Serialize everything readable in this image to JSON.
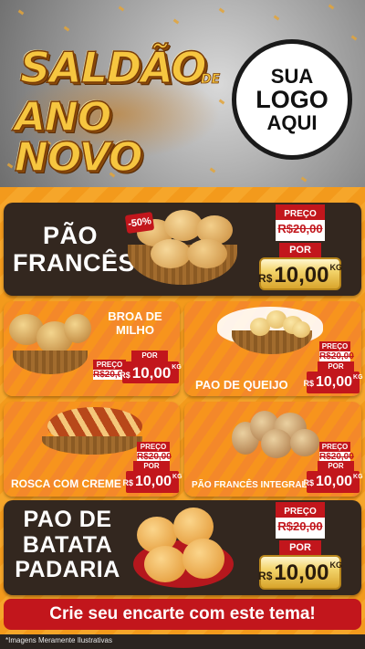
{
  "header": {
    "title_line1": "SALDÃO",
    "title_de": "DE",
    "title_line2": "ANO NOVO",
    "logo_line1": "SUA",
    "logo_line2": "LOGO",
    "logo_line3": "AQUI"
  },
  "products": {
    "pao_frances": {
      "name": "PÃO FRANCÊS",
      "discount": "-50%",
      "preco_label": "PREÇO",
      "old_price": "R$20,00",
      "por_label": "POR",
      "currency": "R$",
      "price": "10,00",
      "unit": "KG"
    },
    "broa": {
      "name": "BROA DE MILHO",
      "preco_label": "PREÇO",
      "old_price": "R$20,00",
      "por_label": "POR",
      "currency": "R$",
      "price": "10,00",
      "unit": "KG"
    },
    "pao_queijo": {
      "name": "PAO DE QUEIJO",
      "preco_label": "PREÇO",
      "old_price": "R$20,00",
      "por_label": "POR",
      "currency": "R$",
      "price": "10,00",
      "unit": "KG"
    },
    "rosca": {
      "name": "ROSCA COM CREME",
      "preco_label": "PREÇO",
      "old_price": "R$20,00",
      "por_label": "POR",
      "currency": "R$",
      "price": "10,00",
      "unit": "KG"
    },
    "pao_integral": {
      "name": "PÃO FRANCÊS INTEGRAL",
      "preco_label": "PREÇO",
      "old_price": "R$20,00",
      "por_label": "POR",
      "currency": "R$",
      "price": "10,00",
      "unit": "KG"
    },
    "pao_batata": {
      "name": "PAO DE BATATA PADARIA",
      "preco_label": "PREÇO",
      "old_price": "R$20,00",
      "por_label": "POR",
      "currency": "R$",
      "price": "10,00",
      "unit": "KG"
    }
  },
  "footer": {
    "cta": "Crie seu encarte com este tema!",
    "disclaimer": "*Imagens Meramente Ilustrativas"
  },
  "colors": {
    "red": "#c2161c",
    "orange": "#f39a1c",
    "dark": "#33271f",
    "gold": "#f3d46b"
  }
}
